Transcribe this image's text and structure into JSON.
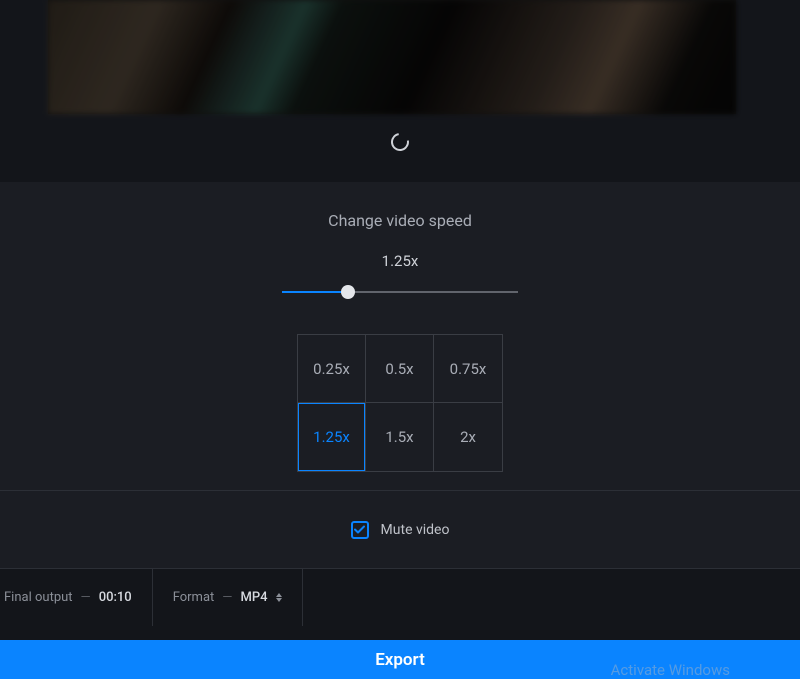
{
  "speed": {
    "title": "Change video speed",
    "current_label": "1.25x",
    "slider_percent": 28,
    "options": [
      "0.25x",
      "0.5x",
      "0.75x",
      "1.25x",
      "1.5x",
      "2x"
    ],
    "active_index": 3
  },
  "mute": {
    "label": "Mute video",
    "checked": true
  },
  "status": {
    "final_output_label": "Final output",
    "final_output_value": "00:10",
    "format_label": "Format",
    "format_value": "MP4"
  },
  "export_label": "Export",
  "watermark": "Activate Windows",
  "colors": {
    "accent": "#0a84ff"
  }
}
